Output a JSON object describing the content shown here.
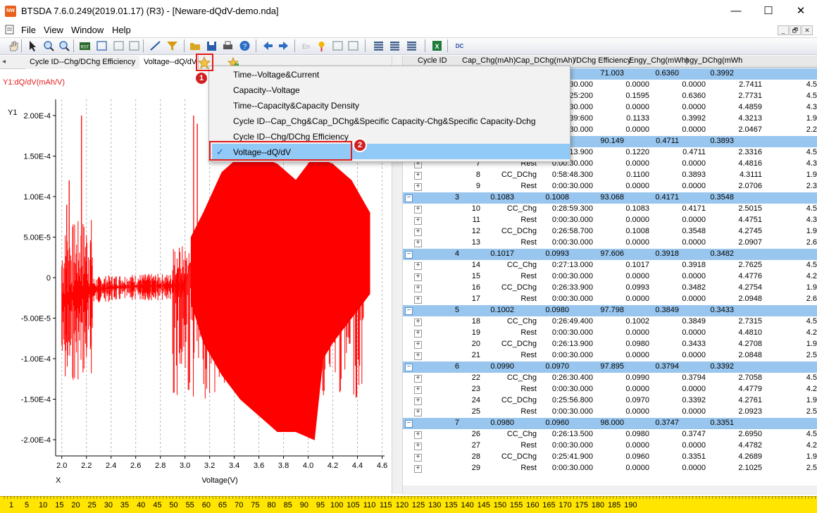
{
  "window": {
    "title": "BTSDA 7.6.0.249(2019.01.17) (R3) - [Neware-dQdV-demo.nda]",
    "app_icon_text": "NW",
    "minimize": "—",
    "maximize": "☐",
    "close": "✕"
  },
  "menu": {
    "items": [
      "File",
      "View",
      "Window",
      "Help"
    ],
    "mdi_min": "_",
    "mdi_restore": "🗗",
    "mdi_close": "✕"
  },
  "toolbar": {
    "icons": [
      "hand-icon",
      "arrow-icon",
      "zoom-in-icon",
      "zoom-out-icon",
      "reset-icon",
      "data-icon",
      "undo-icon",
      "redo-icon",
      "line-icon",
      "filter-icon",
      "open-icon",
      "save-icon",
      "print-icon",
      "help-icon",
      "back-icon",
      "forward-icon",
      "english-icon",
      "pin-icon",
      "align-left-icon",
      "align-right-icon",
      "table-icon",
      "table2-icon",
      "table3-icon",
      "excel-icon",
      "convert-icon"
    ],
    "en_label": "En",
    "dc_label": "DC"
  },
  "tabs": {
    "scroll_left": "◂",
    "items": [
      "Cycle ID--Chg/DChg Efficiency",
      "Voltage--dQ/dV"
    ],
    "active_index": 1
  },
  "chart": {
    "y_axis_caption": "Y1:dQ/dV(mAh/V)",
    "y_title": "Y1",
    "x_title": "X",
    "xlabel": "Voltage(V)",
    "series_color": "#ff0000",
    "y_ticks": [
      "2.00E-4",
      "1.50E-4",
      "1.00E-4",
      "5.00E-5",
      "0",
      "-5.00E-5",
      "-1.00E-4",
      "-1.50E-4",
      "-2.00E-4"
    ],
    "x_ticks": [
      "2.0",
      "2.2",
      "2.4",
      "2.6",
      "2.8",
      "3.0",
      "3.2",
      "3.4",
      "3.6",
      "3.8",
      "4.0",
      "4.2",
      "4.4",
      "4.6"
    ]
  },
  "chart_data": {
    "type": "line",
    "xlabel": "Voltage(V)",
    "ylabel": "Y1:dQ/dV(mAh/V)",
    "xlim": [
      1.95,
      4.62
    ],
    "ylim": [
      -0.00022,
      0.00022
    ],
    "grid": "vertical dashed",
    "series": [
      {
        "x": [
          2.0,
          2.05,
          2.1,
          2.15,
          2.2,
          2.3,
          2.4,
          2.5,
          2.6,
          2.7,
          2.8,
          2.9,
          3.0,
          3.05,
          3.1,
          3.15,
          3.2,
          3.3,
          3.4,
          3.5,
          3.6,
          3.7,
          3.8,
          3.9,
          4.0,
          4.1,
          4.2,
          4.3,
          4.4,
          4.5
        ],
        "y": [
          -3e-05,
          -2.5e-05,
          -2e-05,
          -1.8e-05,
          -1.6e-05,
          -1.4e-05,
          -1.3e-05,
          -1.2e-05,
          -1.1e-05,
          -1.1e-05,
          -1e-05,
          -9e-06,
          -9e-06,
          2e-05,
          4e-05,
          5e-05,
          6e-05,
          8e-05,
          9e-05,
          0.0001,
          0.0001,
          9e-05,
          8e-05,
          7e-05,
          9e-05,
          0.0001,
          9e-05,
          8e-05,
          7e-05,
          1e-05
        ]
      }
    ]
  },
  "grid": {
    "headers": [
      "Cycle ID",
      "Cap_Chg(mAh)",
      "Cap_DChg(mAh)",
      "/DChg Efficiency",
      "Engy_Chg(mWh)",
      "ngy_DChg(mWh"
    ],
    "rows": [
      {
        "kind": "cycle",
        "id": "",
        "chg": "",
        "dchg": "",
        "eff": "71.003",
        "ec": "0.6360",
        "ed": "0.3992"
      },
      {
        "kind": "step",
        "step": "",
        "type": "",
        "time": "0:00:30.000",
        "a": "0.0000",
        "b": "0.0000",
        "c": "2.7411",
        "d": "4.5"
      },
      {
        "kind": "step",
        "step": "",
        "type": "",
        "time": "0:25:200",
        "a": "0.1595",
        "b": "0.6360",
        "c": "2.7731",
        "d": "4.5"
      },
      {
        "kind": "step",
        "step": "",
        "type": "",
        "time": "0:00:30.000",
        "a": "0.0000",
        "b": "0.0000",
        "c": "4.4859",
        "d": "4.3"
      },
      {
        "kind": "step",
        "step": "",
        "type": "",
        "time": "0:39:600",
        "a": "0.1133",
        "b": "0.3992",
        "c": "4.3213",
        "d": "1.9"
      },
      {
        "kind": "step",
        "step": "",
        "type": "",
        "time": "0:00:30.000",
        "a": "0.0000",
        "b": "0.0000",
        "c": "2.0467",
        "d": "2.2"
      },
      {
        "kind": "cycle",
        "id": "",
        "chg": "",
        "dchg": "",
        "eff": "90.149",
        "ec": "0.4711",
        "ed": "0.3893"
      },
      {
        "kind": "step",
        "step": "",
        "type": "",
        "time": "0:13.900",
        "a": "0.1220",
        "b": "0.4711",
        "c": "2.3316",
        "d": "4.5"
      },
      {
        "kind": "step",
        "step": "7",
        "type": "Rest",
        "time": "0:00:30.000",
        "a": "0.0000",
        "b": "0.0000",
        "c": "4.4816",
        "d": "4.3"
      },
      {
        "kind": "step",
        "step": "8",
        "type": "CC_DChg",
        "time": "0:58:48.300",
        "a": "0.1100",
        "b": "0.3893",
        "c": "4.3111",
        "d": "1.9"
      },
      {
        "kind": "step",
        "step": "9",
        "type": "Rest",
        "time": "0:00:30.000",
        "a": "0.0000",
        "b": "0.0000",
        "c": "2.0706",
        "d": "2.3"
      },
      {
        "kind": "cycle",
        "id": "3",
        "chg": "0.1083",
        "dchg": "0.1008",
        "eff": "93.068",
        "ec": "0.4171",
        "ed": "0.3548"
      },
      {
        "kind": "step",
        "step": "10",
        "type": "CC_Chg",
        "time": "0:28:59.300",
        "a": "0.1083",
        "b": "0.4171",
        "c": "2.5015",
        "d": "4.5"
      },
      {
        "kind": "step",
        "step": "11",
        "type": "Rest",
        "time": "0:00:30.000",
        "a": "0.0000",
        "b": "0.0000",
        "c": "4.4751",
        "d": "4.3"
      },
      {
        "kind": "step",
        "step": "12",
        "type": "CC_DChg",
        "time": "0:26:58.700",
        "a": "0.1008",
        "b": "0.3548",
        "c": "4.2745",
        "d": "1.9"
      },
      {
        "kind": "step",
        "step": "13",
        "type": "Rest",
        "time": "0:00:30.000",
        "a": "0.0000",
        "b": "0.0000",
        "c": "2.0907",
        "d": "2.6"
      },
      {
        "kind": "cycle",
        "id": "4",
        "chg": "0.1017",
        "dchg": "0.0993",
        "eff": "97.606",
        "ec": "0.3918",
        "ed": "0.3482"
      },
      {
        "kind": "step",
        "step": "14",
        "type": "CC_Chg",
        "time": "0:27:13.000",
        "a": "0.1017",
        "b": "0.3918",
        "c": "2.7625",
        "d": "4.5"
      },
      {
        "kind": "step",
        "step": "15",
        "type": "Rest",
        "time": "0:00:30.000",
        "a": "0.0000",
        "b": "0.0000",
        "c": "4.4776",
        "d": "4.2"
      },
      {
        "kind": "step",
        "step": "16",
        "type": "CC_DChg",
        "time": "0:26:33.900",
        "a": "0.0993",
        "b": "0.3482",
        "c": "4.2754",
        "d": "1.9"
      },
      {
        "kind": "step",
        "step": "17",
        "type": "Rest",
        "time": "0:00:30.000",
        "a": "0.0000",
        "b": "0.0000",
        "c": "2.0948",
        "d": "2.6"
      },
      {
        "kind": "cycle",
        "id": "5",
        "chg": "0.1002",
        "dchg": "0.0980",
        "eff": "97.798",
        "ec": "0.3849",
        "ed": "0.3433"
      },
      {
        "kind": "step",
        "step": "18",
        "type": "CC_Chg",
        "time": "0:26:49.400",
        "a": "0.1002",
        "b": "0.3849",
        "c": "2.7315",
        "d": "4.5"
      },
      {
        "kind": "step",
        "step": "19",
        "type": "Rest",
        "time": "0:00:30.000",
        "a": "0.0000",
        "b": "0.0000",
        "c": "4.4810",
        "d": "4.2"
      },
      {
        "kind": "step",
        "step": "20",
        "type": "CC_DChg",
        "time": "0:26:13.900",
        "a": "0.0980",
        "b": "0.3433",
        "c": "4.2708",
        "d": "1.9"
      },
      {
        "kind": "step",
        "step": "21",
        "type": "Rest",
        "time": "0:00:30.000",
        "a": "0.0000",
        "b": "0.0000",
        "c": "2.0848",
        "d": "2.5"
      },
      {
        "kind": "cycle",
        "id": "6",
        "chg": "0.0990",
        "dchg": "0.0970",
        "eff": "97.895",
        "ec": "0.3794",
        "ed": "0.3392"
      },
      {
        "kind": "step",
        "step": "22",
        "type": "CC_Chg",
        "time": "0:26:30.400",
        "a": "0.0990",
        "b": "0.3794",
        "c": "2.7058",
        "d": "4.5"
      },
      {
        "kind": "step",
        "step": "23",
        "type": "Rest",
        "time": "0:00:30.000",
        "a": "0.0000",
        "b": "0.0000",
        "c": "4.4779",
        "d": "4.2"
      },
      {
        "kind": "step",
        "step": "24",
        "type": "CC_DChg",
        "time": "0:25:56.800",
        "a": "0.0970",
        "b": "0.3392",
        "c": "4.2761",
        "d": "1.9"
      },
      {
        "kind": "step",
        "step": "25",
        "type": "Rest",
        "time": "0:00:30.000",
        "a": "0.0000",
        "b": "0.0000",
        "c": "2.0923",
        "d": "2.5"
      },
      {
        "kind": "cycle",
        "id": "7",
        "chg": "0.0980",
        "dchg": "0.0960",
        "eff": "98.000",
        "ec": "0.3747",
        "ed": "0.3351"
      },
      {
        "kind": "step",
        "step": "26",
        "type": "CC_Chg",
        "time": "0:26:13.500",
        "a": "0.0980",
        "b": "0.3747",
        "c": "2.6950",
        "d": "4.5"
      },
      {
        "kind": "step",
        "step": "27",
        "type": "Rest",
        "time": "0:00:30.000",
        "a": "0.0000",
        "b": "0.0000",
        "c": "4.4782",
        "d": "4.2"
      },
      {
        "kind": "step",
        "step": "28",
        "type": "CC_DChg",
        "time": "0:25:41.900",
        "a": "0.0960",
        "b": "0.3351",
        "c": "4.2689",
        "d": "1.9"
      },
      {
        "kind": "step",
        "step": "29",
        "type": "Rest",
        "time": "0:00:30.000",
        "a": "0.0000",
        "b": "0.0000",
        "c": "2.1025",
        "d": "2.5"
      }
    ],
    "expand_glyph": "+",
    "collapse_glyph": "−"
  },
  "popup": {
    "items": [
      "Time--Voltage&Current",
      "Capacity--Voltage",
      "Time--Capacity&Capacity Density",
      "Cycle ID--Cap_Chg&Cap_DChg&Specific Capacity-Chg&Specific Capacity-Dchg",
      "Cycle ID--Chg/DChg Efficiency",
      "Voltage--dQ/dV"
    ],
    "selected_index": 5,
    "check_mark": "✓"
  },
  "annotations": {
    "badge1": "1",
    "badge2": "2",
    "highlight_color": "#e31b1b"
  },
  "ruler": {
    "labels": [
      "1",
      "5",
      "10",
      "15",
      "20",
      "25",
      "30",
      "35",
      "40",
      "45",
      "50",
      "55",
      "60",
      "65",
      "70",
      "75",
      "80",
      "85",
      "90",
      "95",
      "100",
      "105",
      "110",
      "115",
      "120",
      "125",
      "130",
      "135",
      "140",
      "145",
      "150",
      "155",
      "160",
      "165",
      "170",
      "175",
      "180",
      "185",
      "190"
    ]
  }
}
